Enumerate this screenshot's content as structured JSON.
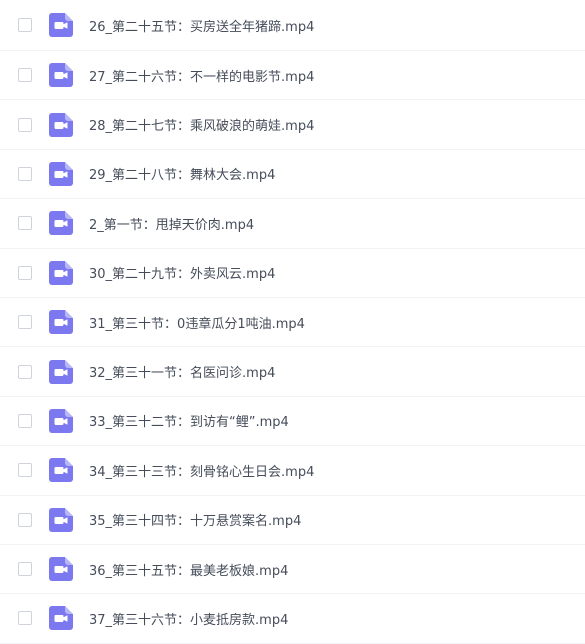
{
  "colors": {
    "icon_bg": "#7b78f0",
    "icon_glyph": "#ffffff",
    "text": "#454d5a"
  },
  "icons": {
    "file_type": "video-file-icon",
    "checkbox": "checkbox"
  },
  "files": [
    {
      "name": "26_第二十五节：买房送全年猪蹄.mp4"
    },
    {
      "name": "27_第二十六节：不一样的电影节.mp4"
    },
    {
      "name": "28_第二十七节：乘风破浪的萌娃.mp4"
    },
    {
      "name": "29_第二十八节：舞林大会.mp4"
    },
    {
      "name": "2_第一节：甩掉天价肉.mp4"
    },
    {
      "name": "30_第二十九节：外卖风云.mp4"
    },
    {
      "name": "31_第三十节：0违章瓜分1吨油.mp4"
    },
    {
      "name": "32_第三十一节：名医问诊.mp4"
    },
    {
      "name": "33_第三十二节：到访有“鲤”.mp4"
    },
    {
      "name": "34_第三十三节：刻骨铭心生日会.mp4"
    },
    {
      "name": "35_第三十四节：十万悬赏案名.mp4"
    },
    {
      "name": "36_第三十五节：最美老板娘.mp4"
    },
    {
      "name": "37_第三十六节：小麦抵房款.mp4"
    }
  ]
}
